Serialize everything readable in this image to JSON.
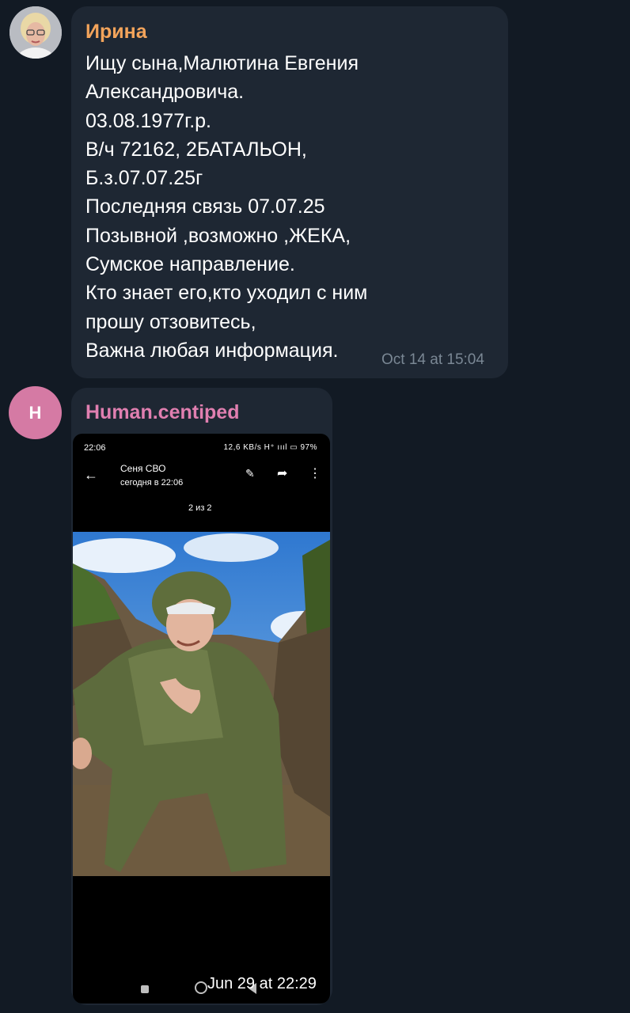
{
  "messages": [
    {
      "sender": "Ирина",
      "text": "Ищу сына,Малютина Евгения\nАлександровича.\n03.08.1977г.р.\nВ/ч 72162, 2БАТАЛЬОН,\nБ.з.07.07.25г\nПоследняя связь 07.07.25\nПозывной ,возможно ,ЖЕКА,\nСумское направление.\nКто знает его,кто уходил с ним\nпрошу отзовитесь,\nВажна любая информация.",
      "time": "Oct 14 at 15:04",
      "name_color": "#f3a45b"
    },
    {
      "sender": "Human.centiped",
      "avatar_letter": "H",
      "time": "Jun 29 at 22:29",
      "name_color": "#e07fb0",
      "avatar_color": "#d57aa4",
      "screenshot": {
        "clock": "22:06",
        "status": "12,6 KB/s  H⁺ ıııl  ▭ 97%",
        "contact": "Сеня СВО",
        "subtitle": "сегодня в 22:06",
        "counter": "2 из 2"
      }
    }
  ]
}
